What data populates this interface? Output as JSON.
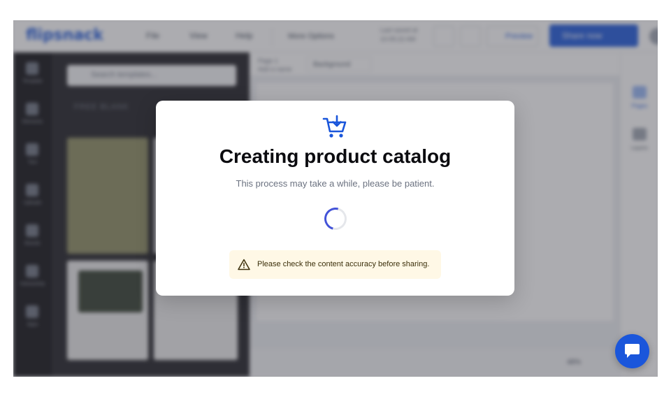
{
  "app": {
    "logo_text": "flipsnack",
    "menu": [
      "File",
      "View",
      "Help"
    ],
    "more_options_label": "More Options",
    "save_note": [
      "Last saved at",
      "10:05:22 AM"
    ],
    "preview_label": "Preview",
    "share_label": "Share now",
    "accent": "#1a56db"
  },
  "left_rail": {
    "items": [
      "Template",
      "Elements",
      "Text",
      "Uploads",
      "Brands",
      "Interactivity",
      "Apps"
    ]
  },
  "templates_panel": {
    "search_placeholder": "Search templates...",
    "heading": "FREE BLANK"
  },
  "canvas": {
    "page_label": [
      "Page 1",
      "Add a name"
    ],
    "background_label": "Background",
    "zoom": "48%"
  },
  "right_rail": {
    "items": [
      "Pages",
      "Layers"
    ]
  },
  "modal": {
    "icon": "cart-plus-icon",
    "title": "Creating product catalog",
    "subtitle": "This process may take a while, please be patient.",
    "warning_icon": "warning-triangle-icon",
    "warning_text": "Please check the content accuracy before sharing.",
    "spinner_color": "#4353d8",
    "warning_bg": "#fff8e6"
  },
  "chat": {
    "icon": "chat-bubble-icon"
  }
}
